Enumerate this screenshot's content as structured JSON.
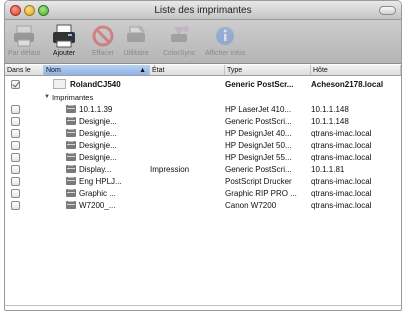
{
  "window": {
    "title": "Liste des imprimantes"
  },
  "toolbar": {
    "default_label": "Par défaut",
    "add_label": "Ajouter",
    "delete_label": "Effacer",
    "utility_label": "Utilitaire",
    "colorsync_label": "ColorSync",
    "info_label": "Afficher infos"
  },
  "columns": {
    "in_menu": "Dans le",
    "name": "Nom",
    "state": "État",
    "type": "Type",
    "host": "Hôte"
  },
  "top_printer": {
    "name": "RolandCJ540",
    "state": "",
    "type": "Generic PostScr...",
    "host": "Acheson2178.local"
  },
  "group_label": "Imprimantes",
  "printers": [
    {
      "name": "10.1.1.39",
      "state": "",
      "type": "HP LaserJet 410...",
      "host": "10.1.1.148"
    },
    {
      "name": "Designje...",
      "state": "",
      "type": "Generic PostScri...",
      "host": "10.1.1.148"
    },
    {
      "name": "Designje...",
      "state": "",
      "type": "HP DesignJet 40...",
      "host": "qtrans-imac.local"
    },
    {
      "name": "Designje...",
      "state": "",
      "type": "HP DesignJet 50...",
      "host": "qtrans-imac.local"
    },
    {
      "name": "Designje...",
      "state": "",
      "type": "HP DesignJet 55...",
      "host": "qtrans-imac.local"
    },
    {
      "name": "Display...",
      "state": "Impression",
      "type": "Generic PostScri...",
      "host": "10.1.1.81"
    },
    {
      "name": "Eng HPLJ...",
      "state": "",
      "type": "PostScript Drucker",
      "host": "qtrans-imac.local"
    },
    {
      "name": "Graphic ...",
      "state": "",
      "type": "Graphic RIP PRO ...",
      "host": "qtrans-imac.local"
    },
    {
      "name": "W7200_...",
      "state": "",
      "type": "Canon W7200",
      "host": "qtrans-imac.local"
    }
  ]
}
